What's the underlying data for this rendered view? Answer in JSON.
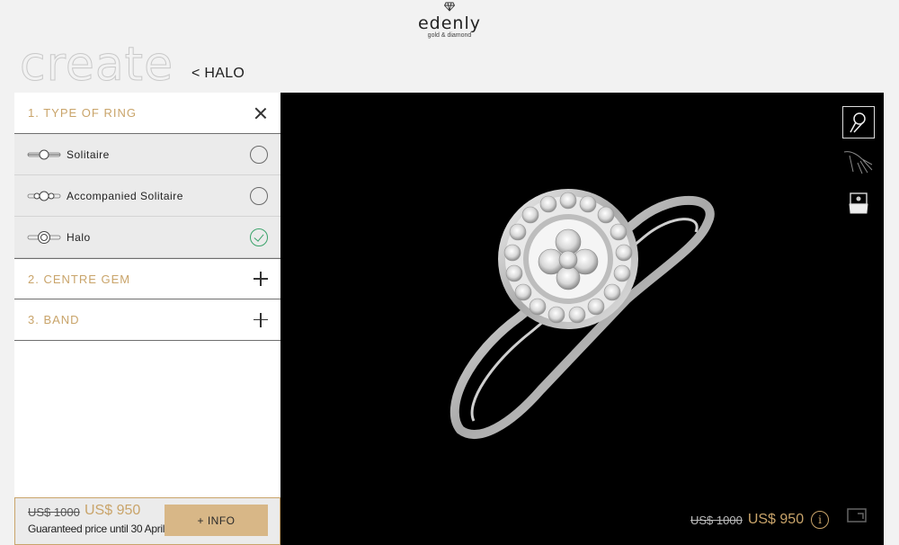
{
  "header": {
    "brand": "edenly",
    "tagline": "gold & diamond"
  },
  "hero": {
    "create_word": "create",
    "breadcrumb": "< HALO"
  },
  "configurator": {
    "sections": [
      {
        "title": "1. TYPE OF RING",
        "state": "expanded"
      },
      {
        "title": "2. CENTRE GEM",
        "state": "collapsed"
      },
      {
        "title": "3. BAND",
        "state": "collapsed"
      }
    ],
    "ring_types": [
      {
        "label": "Solitaire",
        "selected": false
      },
      {
        "label": "Accompanied Solitaire",
        "selected": false
      },
      {
        "label": "Halo",
        "selected": true
      }
    ]
  },
  "pricing": {
    "old_price": "US$ 1000",
    "new_price": "US$ 950",
    "guarantee": "Guaranteed price until 30 April",
    "info_button": "+ INFO"
  },
  "viewer": {
    "thumbnails": [
      "ring-view-icon",
      "hand-view-icon",
      "box-view-icon"
    ],
    "active_thumbnail": 0
  },
  "colors": {
    "accent": "#c9a46a",
    "button": "#d8b787",
    "viewer_bg": "#000000",
    "check": "#3aa36a"
  }
}
